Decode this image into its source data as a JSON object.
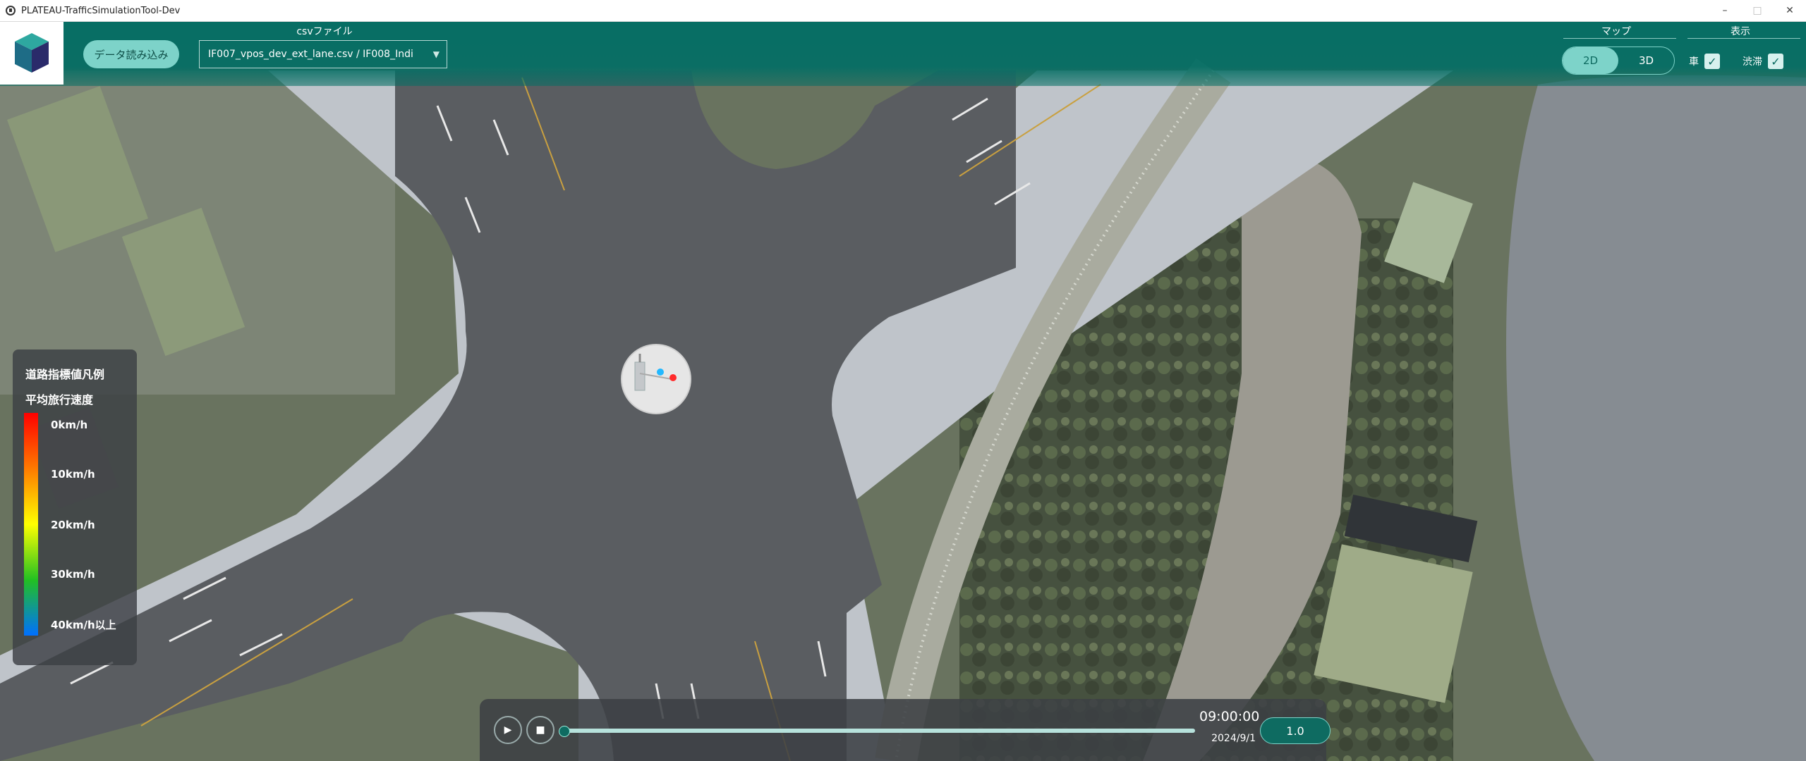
{
  "window": {
    "title": "PLATEAU-TrafficSimulationTool-Dev",
    "controls": {
      "minimize": "–",
      "maximize": "□",
      "close": "✕"
    }
  },
  "toolbar": {
    "load_button": "データ読み込み",
    "csv_label": "csvファイル",
    "csv_value": "IF007_vpos_dev_ext_lane.csv / IF008_Indi",
    "map_label": "マップ",
    "map_modes": [
      "2D",
      "3D"
    ],
    "map_active": "2D",
    "display_label": "表示",
    "display_options": [
      {
        "label": "車",
        "checked": true
      },
      {
        "label": "渋滞",
        "checked": true
      }
    ]
  },
  "legend": {
    "title": "道路指標値凡例",
    "subtitle": "平均旅行速度",
    "ticks": [
      "0km/h",
      "10km/h",
      "20km/h",
      "30km/h",
      "40km/h以上"
    ],
    "gradient_colors": [
      "#ff0000",
      "#ff7a00",
      "#ffff00",
      "#22c022",
      "#0070ff"
    ]
  },
  "playback": {
    "time": "09:00:00",
    "date": "2024/9/1",
    "speed": "1.0",
    "progress": 0
  },
  "colors": {
    "accent": "#056e64",
    "accent_light": "#7dd3c9"
  }
}
